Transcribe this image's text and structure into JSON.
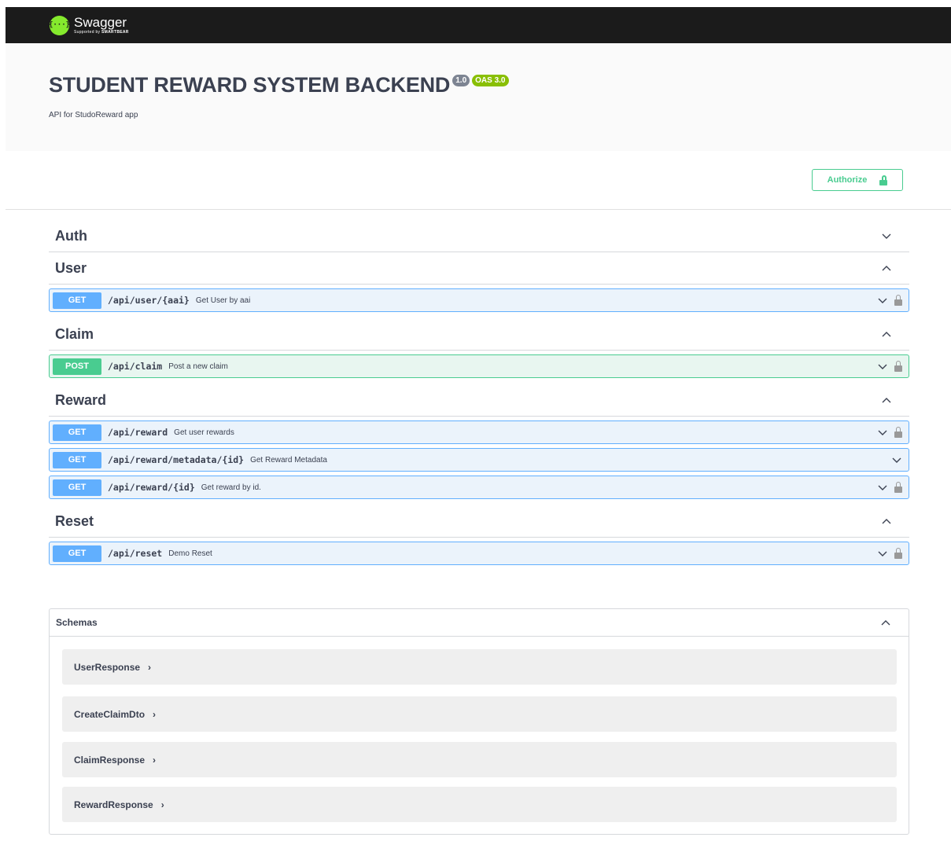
{
  "topbar": {
    "logo_mark": "{···}",
    "logo_name": "Swagger",
    "logo_sub_prefix": "Supported by ",
    "logo_sub_brand": "SMARTBEAR"
  },
  "info": {
    "title": "STUDENT REWARD SYSTEM BACKEND",
    "version": "1.0",
    "oas": "OAS 3.0",
    "description": "API for StudoReward app"
  },
  "authorize": {
    "label": "Authorize"
  },
  "tags": [
    {
      "name": "Auth",
      "expanded": false,
      "operations": []
    },
    {
      "name": "User",
      "expanded": true,
      "operations": [
        {
          "method": "GET",
          "path": "/api/user/{aai}",
          "summary": "Get User by aai",
          "locked": true
        }
      ]
    },
    {
      "name": "Claim",
      "expanded": true,
      "operations": [
        {
          "method": "POST",
          "path": "/api/claim",
          "summary": "Post a new claim",
          "locked": true
        }
      ]
    },
    {
      "name": "Reward",
      "expanded": true,
      "operations": [
        {
          "method": "GET",
          "path": "/api/reward",
          "summary": "Get user rewards",
          "locked": true
        },
        {
          "method": "GET",
          "path": "/api/reward/metadata/{id}",
          "summary": "Get Reward Metadata",
          "locked": false
        },
        {
          "method": "GET",
          "path": "/api/reward/{id}",
          "summary": "Get reward by id.",
          "locked": true
        }
      ]
    },
    {
      "name": "Reset",
      "expanded": true,
      "operations": [
        {
          "method": "GET",
          "path": "/api/reset",
          "summary": "Demo Reset",
          "locked": true
        }
      ]
    }
  ],
  "schemas": {
    "title": "Schemas",
    "models": [
      "UserResponse",
      "CreateClaimDto",
      "ClaimResponse",
      "RewardResponse"
    ],
    "arrow": "›"
  },
  "colors": {
    "get": "#61affe",
    "post": "#49cc90",
    "topbar": "#1b1b1b",
    "logo": "#85ea2d",
    "badge_version": "#7d8492",
    "badge_oas": "#89bf04"
  }
}
